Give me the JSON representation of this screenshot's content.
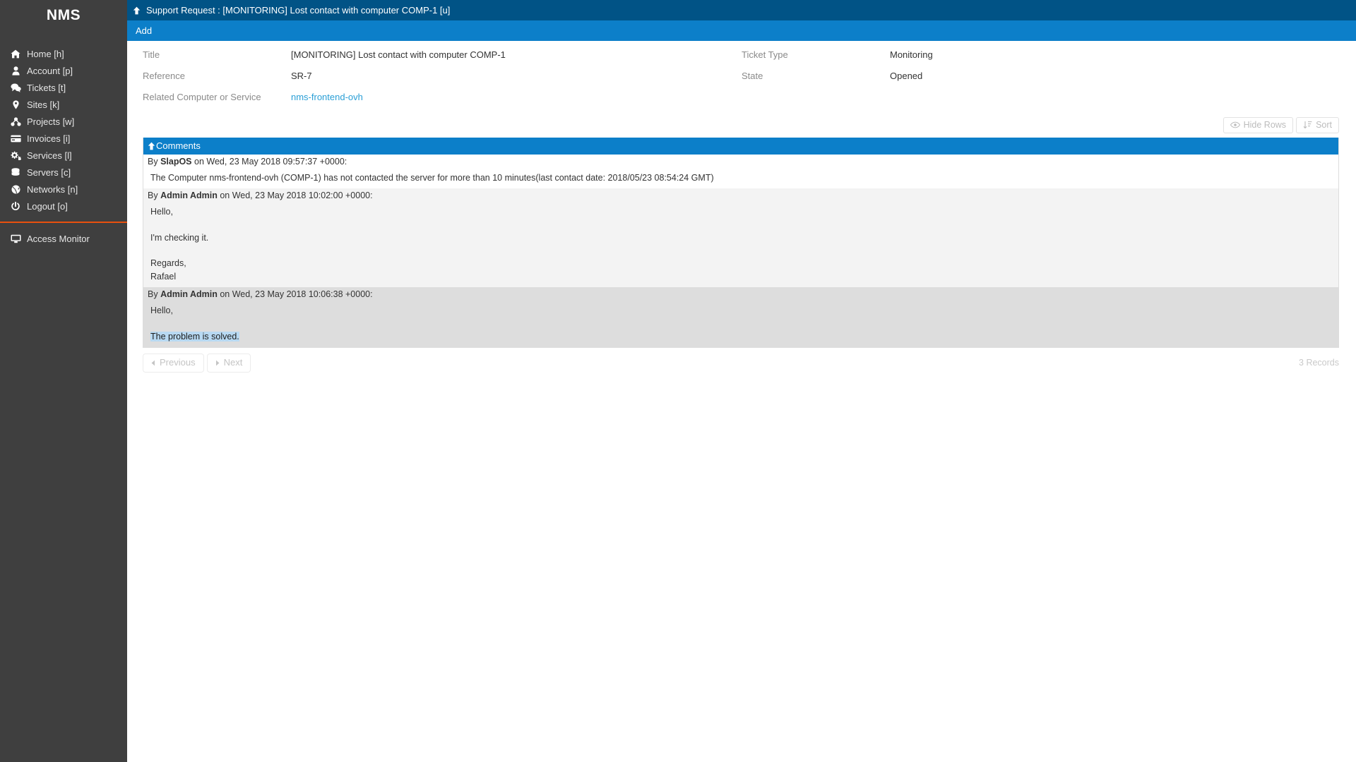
{
  "sidebar": {
    "brand": "NMS",
    "items": [
      {
        "label": "Home [h]",
        "icon": "home-icon"
      },
      {
        "label": "Account [p]",
        "icon": "user-icon"
      },
      {
        "label": "Tickets [t]",
        "icon": "comments-icon"
      },
      {
        "label": "Sites [k]",
        "icon": "map-marker-icon"
      },
      {
        "label": "Projects [w]",
        "icon": "sitemap-icon"
      },
      {
        "label": "Invoices [i]",
        "icon": "credit-card-icon"
      },
      {
        "label": "Services [l]",
        "icon": "cogs-icon"
      },
      {
        "label": "Servers [c]",
        "icon": "database-icon"
      },
      {
        "label": "Networks [n]",
        "icon": "globe-icon"
      },
      {
        "label": "Logout [o]",
        "icon": "power-off-icon"
      }
    ],
    "secondary_items": [
      {
        "label": "Access Monitor",
        "icon": "monitor-icon"
      }
    ],
    "divider_color": "#e8500e",
    "background": "#3f3f3f"
  },
  "header": {
    "icon": "arrow-up-icon",
    "title": "Support Request : [MONITORING] Lost contact with computer COMP-1 [u]",
    "background": "#015386"
  },
  "action_bar": {
    "actions": [
      "Add"
    ],
    "background": "#0c7fc9"
  },
  "fields": {
    "left": [
      {
        "label": "Title",
        "value": "[MONITORING] Lost contact with computer COMP-1",
        "link": false
      },
      {
        "label": "Reference",
        "value": "SR-7",
        "link": false
      },
      {
        "label": "Related Computer or Service",
        "value": "nms-frontend-ovh",
        "link": true
      }
    ],
    "right": [
      {
        "label": "Ticket Type",
        "value": "Monitoring",
        "link": false
      },
      {
        "label": "State",
        "value": "Opened",
        "link": false
      }
    ]
  },
  "list_toolbar": {
    "hide_rows_label": "Hide Rows",
    "hide_rows_icon": "eye-icon",
    "sort_label": "Sort",
    "sort_icon": "sort-icon"
  },
  "comments": {
    "title": "Comments",
    "icon": "arrow-up-icon",
    "entries": [
      {
        "prefix": "By",
        "author": "SlapOS",
        "date_text": "on Wed, 23 May 2018 09:57:37 +0000:",
        "body": "The Computer nms-frontend-ovh (COMP-1) has not contacted the server for more than 10 minutes(last contact date: 2018/05/23 08:54:24 GMT)",
        "body_selected": "",
        "style": "plain"
      },
      {
        "prefix": "By",
        "author": "Admin Admin",
        "date_text": "on Wed, 23 May 2018 10:02:00 +0000:",
        "body": "Hello,\n\nI'm checking it.\n\nRegards,\nRafael",
        "body_selected": "",
        "style": "alt"
      },
      {
        "prefix": "By",
        "author": "Admin Admin",
        "date_text": "on Wed, 23 May 2018 10:06:38 +0000:",
        "body": "Hello,\n\n",
        "body_selected": "The problem is solved.",
        "style": "alt2"
      }
    ]
  },
  "pager": {
    "previous_label": "Previous",
    "next_label": "Next",
    "record_count": "3 Records"
  },
  "colors": {
    "accent_blue": "#0c7fc9",
    "dark_blue": "#015386",
    "sidebar": "#3f3f3f",
    "orange": "#e8500e",
    "link": "#2a9fd6",
    "selection": "#b8d9f2"
  }
}
